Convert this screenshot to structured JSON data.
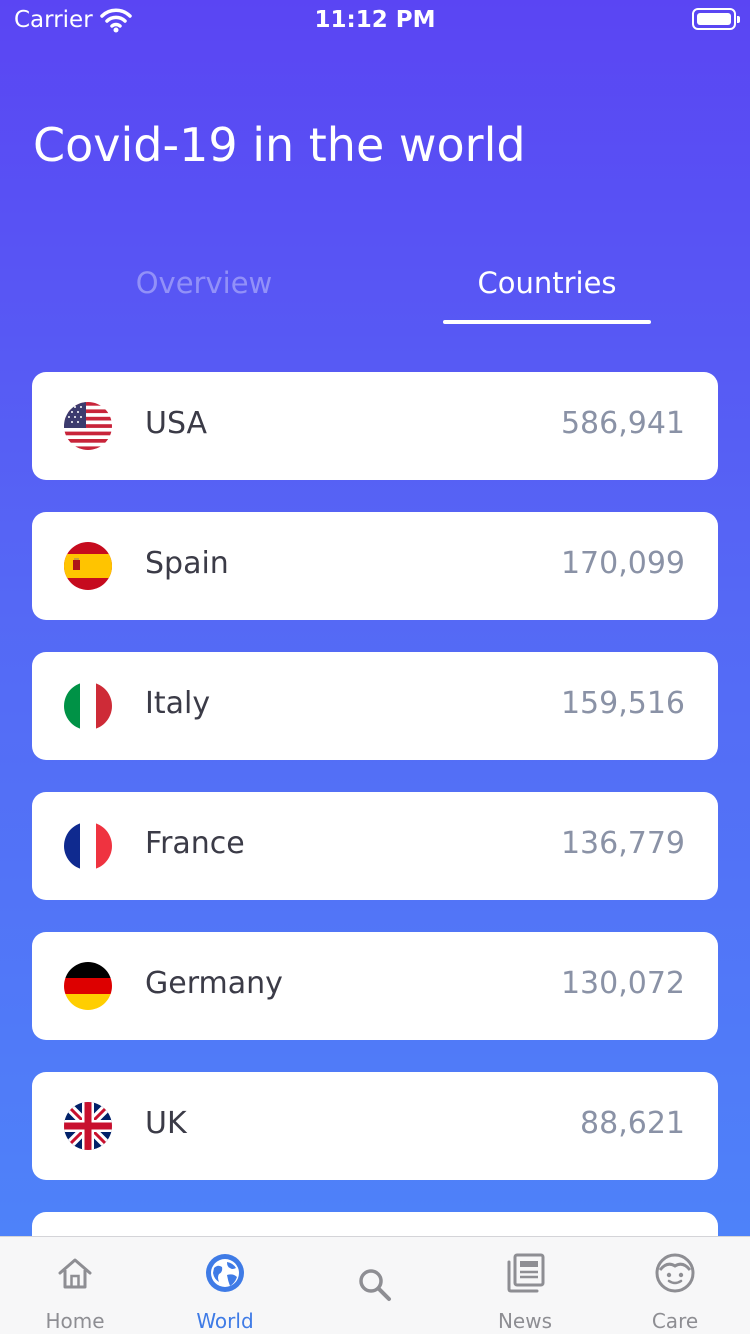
{
  "status_bar": {
    "carrier": "Carrier",
    "time": "11:12 PM"
  },
  "header": {
    "title": "Covid-19 in the world"
  },
  "tabs": [
    {
      "label": "Overview",
      "active": false
    },
    {
      "label": "Countries",
      "active": true
    }
  ],
  "countries": [
    {
      "name": "USA",
      "cases": "586,941",
      "flag": "us-flag-icon"
    },
    {
      "name": "Spain",
      "cases": "170,099",
      "flag": "spain-flag-icon"
    },
    {
      "name": "Italy",
      "cases": "159,516",
      "flag": "italy-flag-icon"
    },
    {
      "name": "France",
      "cases": "136,779",
      "flag": "france-flag-icon"
    },
    {
      "name": "Germany",
      "cases": "130,072",
      "flag": "germany-flag-icon"
    },
    {
      "name": "UK",
      "cases": "88,621",
      "flag": "uk-flag-icon"
    }
  ],
  "tabbar": {
    "items": [
      {
        "label": "Home",
        "icon": "home-icon",
        "active": false
      },
      {
        "label": "World",
        "icon": "globe-icon",
        "active": true
      },
      {
        "label": "",
        "icon": "search-icon",
        "active": false
      },
      {
        "label": "News",
        "icon": "news-icon",
        "active": false
      },
      {
        "label": "Care",
        "icon": "face-icon",
        "active": false
      }
    ]
  },
  "colors": {
    "gradient_top": "#5a45f3",
    "gradient_bottom": "#4d86fa",
    "active_tab": "#3f7be6",
    "inactive_tab": "#8e8e93"
  }
}
